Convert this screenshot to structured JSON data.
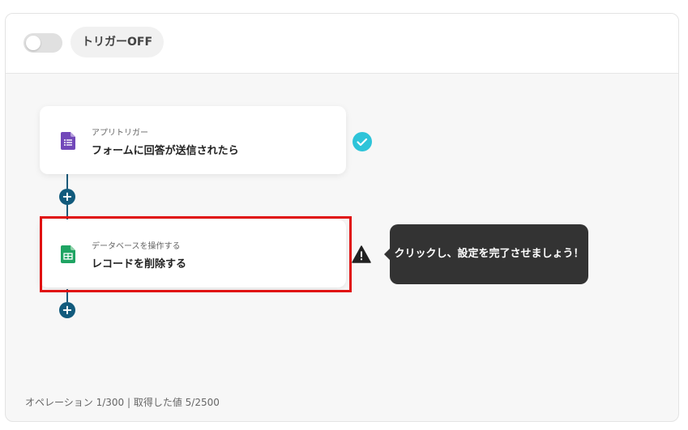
{
  "header": {
    "trigger_toggle_state": "off",
    "trigger_label": "トリガーOFF"
  },
  "flow": {
    "steps": [
      {
        "category": "アプリトリガー",
        "title": "フォームに回答が送信されたら",
        "icon": "google-forms-icon",
        "status": "complete",
        "status_icon": "check-circle-icon",
        "status_color": "#2ec4d9"
      },
      {
        "category": "データベースを操作する",
        "title": "レコードを削除する",
        "icon": "google-sheets-icon",
        "status": "warning",
        "status_icon": "warning-icon",
        "status_color": "#222222"
      }
    ],
    "add_step_label": "+",
    "tooltip": "クリックし、設定を完了させましょう！"
  },
  "footer": {
    "stats": "オペレーション 1/300 | 取得した値 5/2500"
  },
  "colors": {
    "highlight": "#e01010",
    "connector": "#125b7d",
    "forms_purple": "#7248b9",
    "sheets_green": "#1fa463",
    "tooltip_bg": "#333333"
  }
}
